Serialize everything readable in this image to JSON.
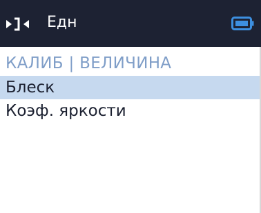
{
  "header": {
    "title": "Едн",
    "nav_icon": "nav-arrows-icon",
    "battery_icon": "battery-icon"
  },
  "section": {
    "heading": "КАЛИБ | ВЕЛИЧИНА"
  },
  "menu": {
    "items": [
      {
        "label": "Блеск",
        "selected": true
      },
      {
        "label": "Коэф. яркости",
        "selected": false
      }
    ]
  },
  "colors": {
    "header_bg": "#1d2233",
    "battery": "#3d8fe0",
    "heading": "#7f9ec8",
    "selection": "#c6d9ef",
    "text": "#1b2030"
  }
}
